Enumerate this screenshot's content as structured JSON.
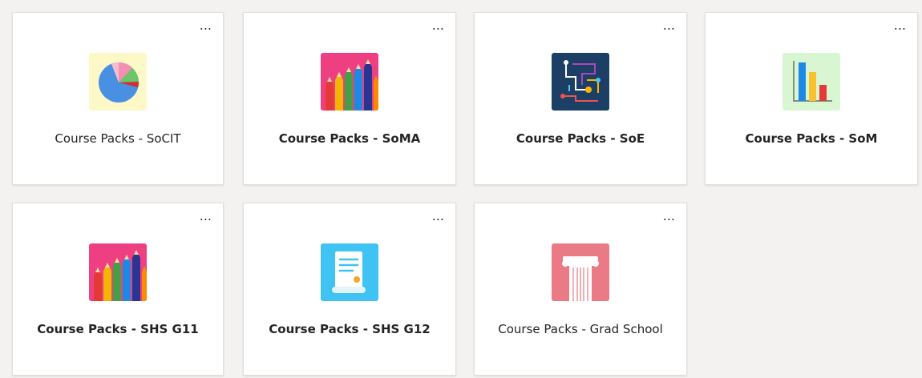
{
  "more_label": "...",
  "cards": [
    {
      "title": "Course Packs - SoCIT",
      "icon": "pie-chart-icon",
      "bold": false,
      "tile_color": "#fdf8c8"
    },
    {
      "title": "Course Packs - SoMA",
      "icon": "colored-pencils-icon",
      "bold": true,
      "tile_color": "#ef3f83"
    },
    {
      "title": "Course Packs - SoE",
      "icon": "circuit-icon",
      "bold": true,
      "tile_color": "#1c3f66"
    },
    {
      "title": "Course Packs - SoM",
      "icon": "bar-chart-icon",
      "bold": true,
      "tile_color": "#d9f6d3"
    },
    {
      "title": "Course Packs - SHS G11",
      "icon": "colored-pencils-icon",
      "bold": true,
      "tile_color": "#ef3f83"
    },
    {
      "title": "Course Packs - SHS G12",
      "icon": "scroll-document-icon",
      "bold": true,
      "tile_color": "#3fc3f2"
    },
    {
      "title": "Course Packs - Grad School",
      "icon": "greek-column-icon",
      "bold": false,
      "tile_color": "#ea7a86"
    }
  ]
}
